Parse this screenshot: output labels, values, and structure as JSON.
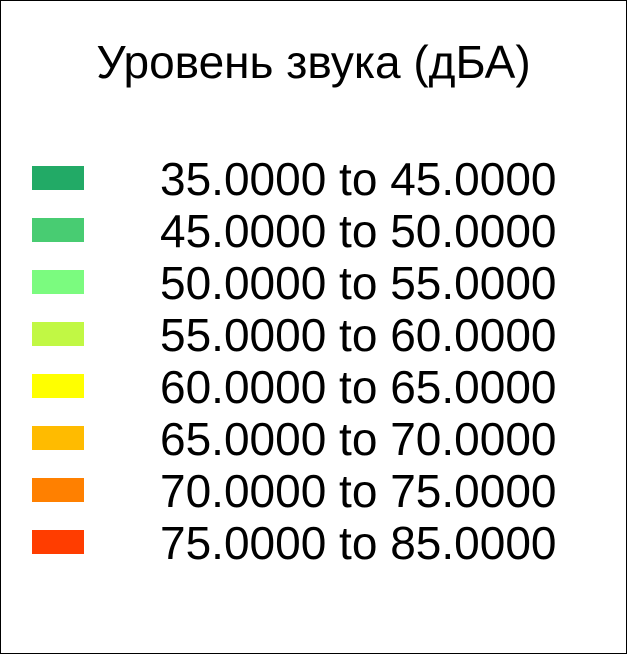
{
  "legend": {
    "title": "Уровень звука (дБА)",
    "items": [
      {
        "label": "35.0000 to 45.0000",
        "color": "#22aa66"
      },
      {
        "label": "45.0000 to 50.0000",
        "color": "#48cc72"
      },
      {
        "label": "50.0000 to 55.0000",
        "color": "#7bfb7f"
      },
      {
        "label": "55.0000 to 60.0000",
        "color": "#c1f844"
      },
      {
        "label": "60.0000 to 65.0000",
        "color": "#ffff00"
      },
      {
        "label": "65.0000 to 70.0000",
        "color": "#ffbb00"
      },
      {
        "label": "70.0000 to 75.0000",
        "color": "#ff8000"
      },
      {
        "label": "75.0000 to 85.0000",
        "color": "#ff3d00"
      }
    ]
  }
}
